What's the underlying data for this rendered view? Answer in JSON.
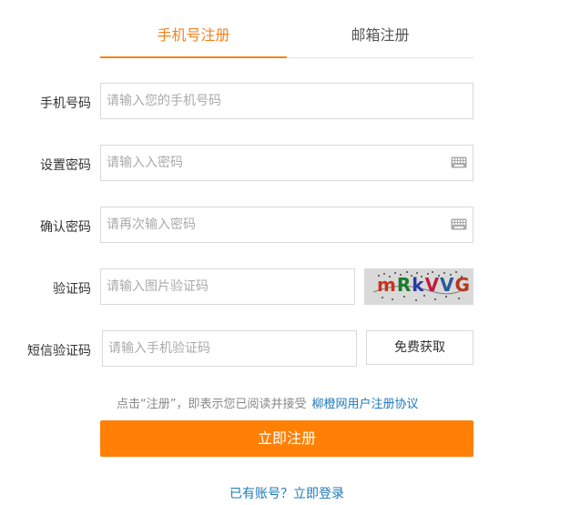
{
  "tabs": {
    "phone": "手机号注册",
    "email": "邮箱注册"
  },
  "form": {
    "phone": {
      "label": "手机号码",
      "placeholder": "请输入您的手机号码"
    },
    "password": {
      "label": "设置密码",
      "placeholder": "请输入入密码"
    },
    "confirm": {
      "label": "确认密码",
      "placeholder": "请再次输入密码"
    },
    "captcha": {
      "label": "验证码",
      "placeholder": "请输入图片验证码",
      "chars": [
        "m",
        "R",
        "k",
        "V",
        "V",
        "G"
      ]
    },
    "sms": {
      "label": "短信验证码",
      "placeholder": "请输入手机验证码",
      "button": "免费获取"
    }
  },
  "agreement": {
    "text": "点击“注册”，即表示您已阅读并接受",
    "link": "柳橙网用户注册协议"
  },
  "submit": "立即注册",
  "login": "已有账号？立即登录",
  "colors": {
    "accent": "#f5821f",
    "button": "#ff8004",
    "link": "#1f79b8"
  }
}
